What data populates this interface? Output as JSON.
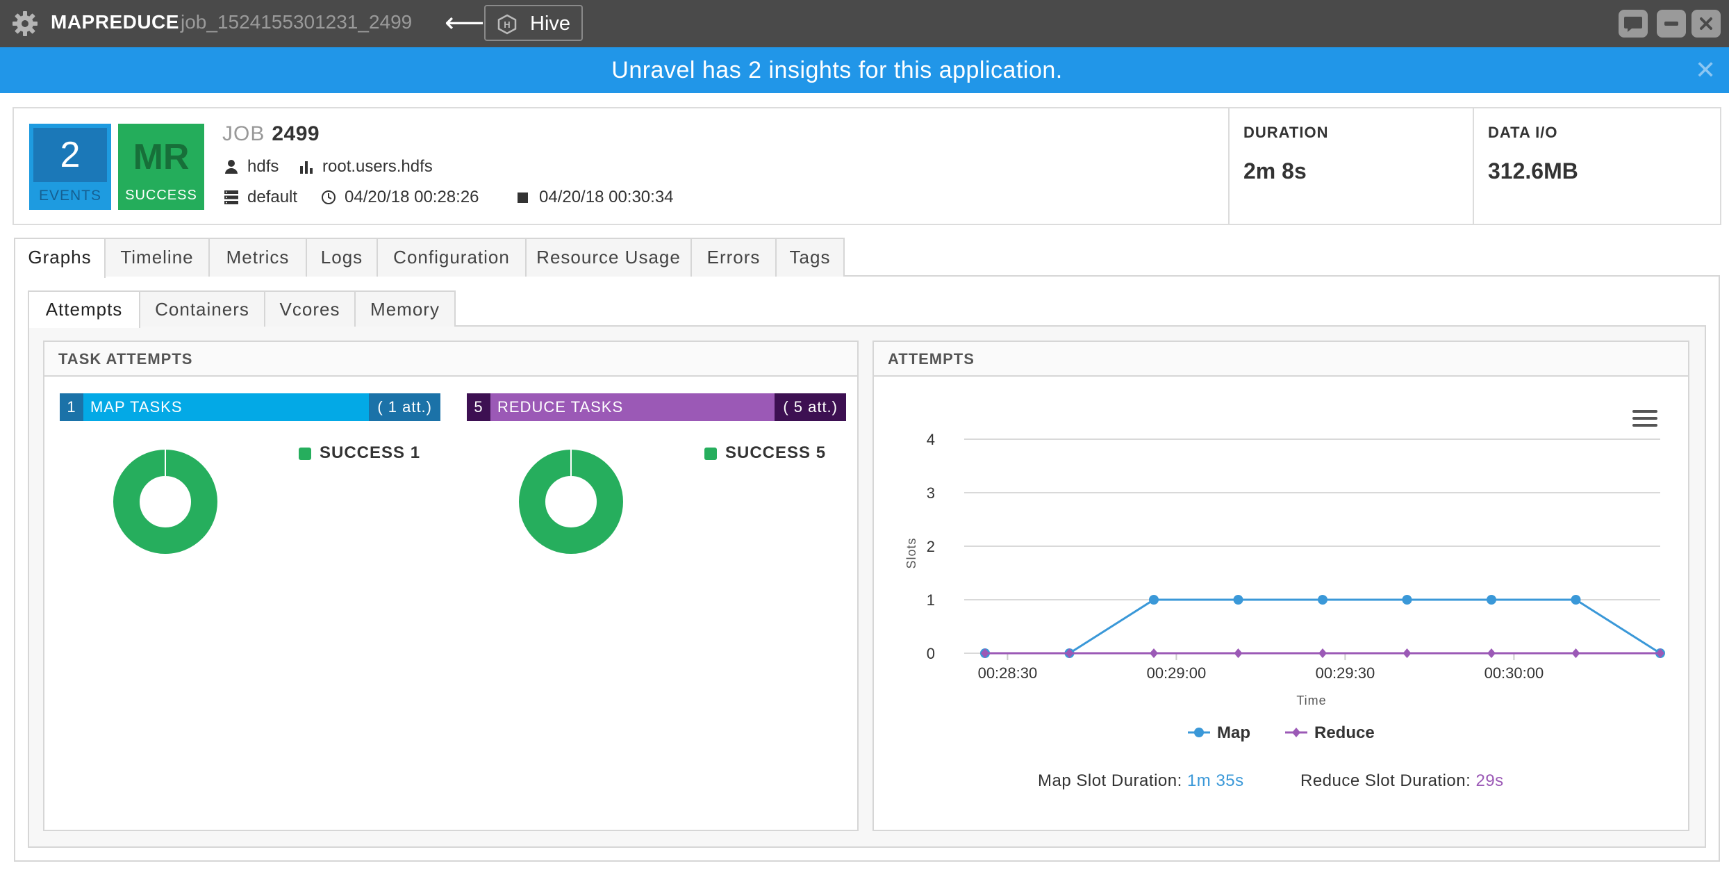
{
  "window": {
    "app_type": "MAPREDUCE",
    "job_id": "job_1524155301231_2499",
    "back_arrow": "⟵",
    "parent_app_label": "Hive"
  },
  "banner": {
    "message": "Unravel has 2 insights for this application.",
    "close_glyph": "✕"
  },
  "job": {
    "events_count": "2",
    "events_label": "EVENTS",
    "kind_code": "MR",
    "status_label": "SUCCESS",
    "title_prefix": "JOB",
    "job_number": "2499",
    "user": "hdfs",
    "queue": "root.users.hdfs",
    "cluster": "default",
    "start_time": "04/20/18 00:28:26",
    "end_time": "04/20/18 00:30:34",
    "duration_label": "DURATION",
    "duration_value": "2m 8s",
    "data_io_label": "DATA I/O",
    "data_io_value": "312.6MB"
  },
  "tabs": [
    "Graphs",
    "Timeline",
    "Metrics",
    "Logs",
    "Configuration",
    "Resource Usage",
    "Errors",
    "Tags"
  ],
  "active_tab": "Graphs",
  "subtabs": [
    "Attempts",
    "Containers",
    "Vcores",
    "Memory"
  ],
  "active_subtab": "Attempts",
  "task_attempts": {
    "title": "TASK ATTEMPTS",
    "map": {
      "count": "1",
      "label": "MAP TASKS",
      "attempts": "( 1 att.)",
      "legend": "SUCCESS 1",
      "success_fraction": 1.0
    },
    "reduce": {
      "count": "5",
      "label": "REDUCE TASKS",
      "attempts": "( 5 att.)",
      "legend": "SUCCESS 5",
      "success_fraction": 1.0
    },
    "colors": {
      "map": "#03a9e6",
      "map_dark": "#1b72a8",
      "reduce": "#9b59b6",
      "reduce_dark": "#3d1052",
      "success": "#26ae5d"
    }
  },
  "attempts_chart": {
    "title": "ATTEMPTS",
    "menu_icon": "hamburger-menu-icon",
    "map_slot_label": "Map Slot Duration:",
    "map_slot_value": "1m 35s",
    "reduce_slot_label": "Reduce Slot Duration:",
    "reduce_slot_value": "29s"
  },
  "chart_data": {
    "type": "line",
    "xlabel": "Time",
    "ylabel": "Slots",
    "ylim": [
      0,
      4
    ],
    "yticks": [
      "0",
      "1",
      "2",
      "3",
      "4"
    ],
    "xticks": [
      "00:28:30",
      "00:29:00",
      "00:29:30",
      "00:30:00"
    ],
    "x": [
      "00:28:26",
      "00:28:41",
      "00:28:56",
      "00:29:11",
      "00:29:26",
      "00:29:41",
      "00:29:56",
      "00:30:11",
      "00:30:26"
    ],
    "series": [
      {
        "name": "Map",
        "color": "#3a98d8",
        "marker": "circle",
        "values": [
          0,
          0,
          1,
          1,
          1,
          1,
          1,
          1,
          0
        ]
      },
      {
        "name": "Reduce",
        "color": "#9b59b6",
        "marker": "diamond",
        "values": [
          0,
          0,
          0,
          0,
          0,
          0,
          0,
          0,
          0
        ]
      }
    ],
    "grid": true,
    "legend_position": "bottom"
  }
}
